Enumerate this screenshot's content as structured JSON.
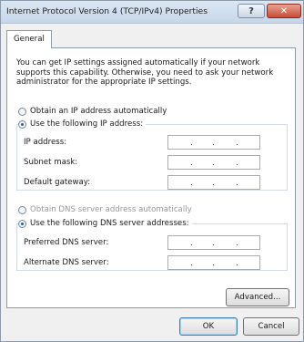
{
  "window": {
    "title": "Internet Protocol Version 4 (TCP/IPv4) Properties",
    "help_label": "?",
    "close_label": "✕"
  },
  "tabs": [
    {
      "label": "General",
      "selected": true
    }
  ],
  "description": "You can get IP settings assigned automatically if your network supports this capability. Otherwise, you need to ask your network administrator for the appropriate IP settings.",
  "ip_settings": {
    "auto_label": "Obtain an IP address automatically",
    "manual_label": "Use the following IP address:",
    "selected": "manual",
    "fields": [
      {
        "label": "IP address:",
        "value": " .  .  ."
      },
      {
        "label": "Subnet mask:",
        "value": " .  .  ."
      },
      {
        "label": "Default gateway:",
        "value": " .  .  ."
      }
    ]
  },
  "dns_settings": {
    "auto_label": "Obtain DNS server address automatically",
    "manual_label": "Use the following DNS server addresses:",
    "selected": "manual",
    "fields": [
      {
        "label": "Preferred DNS server:",
        "value": " .  .  ."
      },
      {
        "label": "Alternate DNS server:",
        "value": " .  .  ."
      }
    ]
  },
  "buttons": {
    "advanced": "Advanced...",
    "ok": "OK",
    "cancel": "Cancel"
  }
}
